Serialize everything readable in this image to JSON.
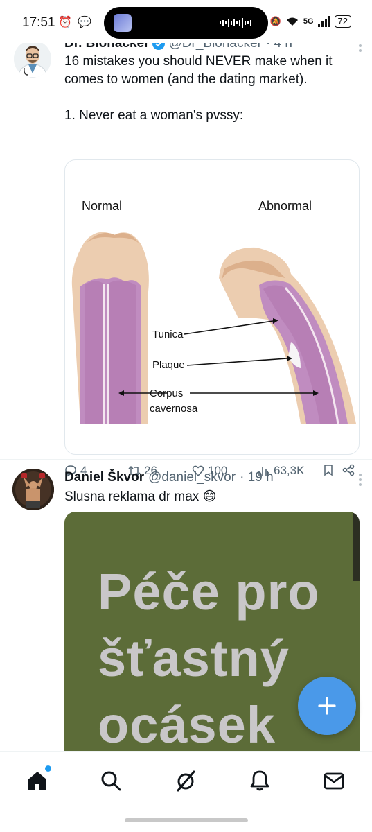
{
  "status_bar": {
    "time": "17:51",
    "network": "5G",
    "battery": "72"
  },
  "tweets": [
    {
      "name": "Dr. Biohacker",
      "handle": "@Dr_Biohacker",
      "time": "· 4 h",
      "text": "16 mistakes you should NEVER make when it comes to women (and the dating market).\n\n1. Never eat a woman's pvssy:",
      "media": {
        "label_normal": "Normal",
        "label_abnormal": "Abnormal",
        "label_tunica": "Tunica",
        "label_plaque": "Plaque",
        "label_corpus": "Corpus",
        "label_cavernosa": "cavernosa"
      },
      "actions": {
        "replies": "4",
        "reposts": "26",
        "likes": "100",
        "views": "63,3K"
      }
    },
    {
      "name": "Daniel Škvor",
      "handle": "@daniel_skvor",
      "time": "· 19 h",
      "text": "Slusna reklama dr max 😄",
      "media": {
        "line1": "Péče pro",
        "line2": "šťastný",
        "line3": "ocásek"
      }
    }
  ],
  "icons": {
    "fab": "plus-icon",
    "nav": [
      "home-icon",
      "search-icon",
      "grok-icon",
      "bell-icon",
      "mail-icon"
    ]
  },
  "colors": {
    "accent": "#1d9bf0",
    "fab": "#4a99e9",
    "billboard": "#5c6c38"
  }
}
